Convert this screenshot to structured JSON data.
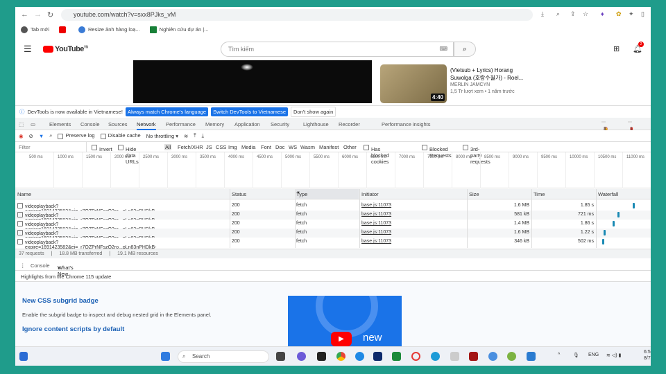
{
  "browser": {
    "url": "youtube.com/watch?v=sxx8PJks_vM",
    "bookmarks": [
      "Tab mới",
      "",
      "Resize ảnh hàng loạ...",
      "Nghiên cứu dự án |..."
    ]
  },
  "youtube": {
    "logo": "YouTube",
    "region": "VN",
    "search_placeholder": "Tìm kiếm",
    "notification_count": "2",
    "suggestion": {
      "title_line1": "(Vietsub + Lyrics) Horang",
      "title_line2": "Suwolga (호랑수월가) - Roel...",
      "channel": "MERLIN JAMCYN",
      "meta": "1,5 Tr lượt xem • 1 năm trước",
      "duration": "4:40"
    }
  },
  "infobar": {
    "text": "DevTools is now available in Vietnamese!",
    "btn1": "Always match Chrome's language",
    "btn2": "Switch DevTools to Vietnamese",
    "btn3": "Don't show again"
  },
  "devtools": {
    "tabs": [
      "Elements",
      "Console",
      "Sources",
      "Network",
      "Performance",
      "Memory",
      "Application",
      "Security",
      "Lighthouse",
      "Recorder",
      "Performance insights"
    ],
    "active_tab": "Network",
    "counts": {
      "errors": "8",
      "warnings": "1",
      "issues": "1"
    },
    "toolbar": {
      "preserve_log": "Preserve log",
      "disable_cache": "Disable cache",
      "throttling": "No throttling"
    },
    "filter": {
      "placeholder": "Filter",
      "invert": "Invert",
      "hide_data_urls": "Hide data URLs",
      "types": [
        "All",
        "Fetch/XHR",
        "JS",
        "CSS",
        "Img",
        "Media",
        "Font",
        "Doc",
        "WS",
        "Wasm",
        "Manifest",
        "Other"
      ],
      "blocked_cookies": "Has blocked cookies",
      "blocked_requests": "Blocked Requests",
      "third_party": "3rd-party requests"
    },
    "timeline_ticks": [
      "500 ms",
      "1000 ms",
      "1500 ms",
      "2000 ms",
      "2500 ms",
      "3000 ms",
      "3500 ms",
      "4000 ms",
      "4500 ms",
      "5000 ms",
      "5500 ms",
      "6000 ms",
      "6500 ms",
      "7000 ms",
      "7500 ms",
      "8000 ms",
      "8500 ms",
      "9000 ms",
      "9500 ms",
      "10000 ms",
      "10500 ms",
      "11000 ms"
    ],
    "columns": [
      "Name",
      "Status",
      "Type",
      "Initiator",
      "Size",
      "Time",
      "Waterfall"
    ],
    "rows": [
      {
        "name": "videoplayback?expire=1691423582&ei=_r7QZPrNFszQ2ro...pLn83nPHDkB-xXW8NprY...",
        "status": "200",
        "type": "fetch",
        "initiator": "base.js:11073",
        "size": "1.6 MB",
        "time": "1.85 s",
        "wf": 0.56
      },
      {
        "name": "videoplayback?expire=1691423582&ei=_r7QZPrNFszQ2ro...pLn83nPHDkB-xXW8NprY...",
        "status": "200",
        "type": "fetch",
        "initiator": "base.js:11073",
        "size": "581 kB",
        "time": "721 ms",
        "wf": 0.31
      },
      {
        "name": "videoplayback?expire=1691423582&ei=_r7QZPrNFszQ2ro...pLn83nPHDkB-xXW8NprY...",
        "status": "200",
        "type": "fetch",
        "initiator": "base.js:11073",
        "size": "1.4 MB",
        "time": "1.86 s",
        "wf": 0.23
      },
      {
        "name": "videoplayback?expire=1691423582&ei=_r7QZPrNFszQ2ro...pLn83nPHDkB-xXW8NprY...",
        "status": "200",
        "type": "fetch",
        "initiator": "base.js:11073",
        "size": "1.6 MB",
        "time": "1.22 s",
        "wf": 0.09
      },
      {
        "name": "videoplayback?expire=1691423582&ei=_r7QZPrNFszQ2ro...pLn83nPHDkB-xXW8NprY...",
        "status": "200",
        "type": "fetch",
        "initiator": "base.js:11073",
        "size": "346 kB",
        "time": "502 ms",
        "wf": 0.07
      }
    ],
    "summary": [
      "37 requests",
      "18.8 MB transferred",
      "19.1 MB resources"
    ],
    "drawer_tabs": [
      "Console",
      "What's New"
    ],
    "highlights": "Highlights from the Chrome 115 update",
    "whatsnew": {
      "h1": "New CSS subgrid badge",
      "p1": "Enable the subgrid badge to inspect and debug nested grid in the Elements panel.",
      "h2": "Ignore content scripts by default",
      "card_text": "new"
    }
  },
  "taskbar": {
    "search": "Search",
    "lang": "ENG",
    "time": "6:5",
    "date": "8/7"
  }
}
